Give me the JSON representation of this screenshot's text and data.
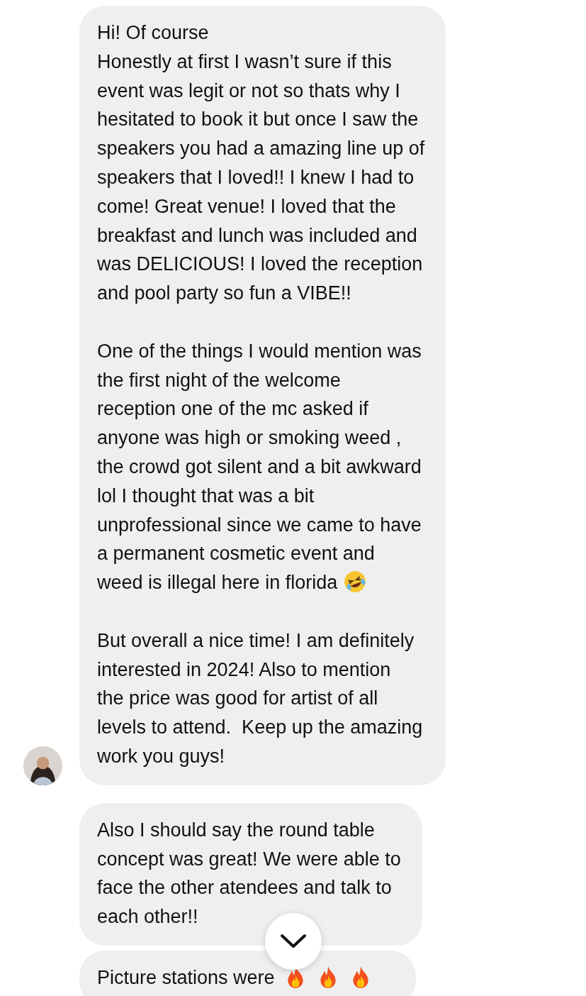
{
  "messages": [
    {
      "avatar": true,
      "paragraphs": [
        {
          "kind": "plain",
          "text": "Hi! Of course\nHonestly at first I wasn’t sure if this\nevent was legit or not so thats why I\nhesitated to book it but once I saw the\nspeakers you had a amazing line up of\nspeakers that I loved!! I knew I had to\ncome! Great venue! I loved that the\nbreakfast and lunch was included and\nwas DELICIOUS! I loved the reception\nand pool party so fun a VIBE!!"
        },
        {
          "kind": "plain",
          "text": "One of the things I would mention was\nthe first night of the welcome\nreception one of the mc asked if\nanyone was high or smoking weed ,\nthe crowd got silent and a bit awkward\nlol I thought that was a bit\nunprofessional since we came to have\na permanent cosmetic event and"
        },
        {
          "kind": "laugh",
          "text": "weed is illegal here in florida"
        },
        {
          "kind": "plain",
          "text": "But overall a nice time! I am definitely\ninterested in 2024! Also to mention\nthe price was good for artist of all\nlevels to attend.  Keep up the amazing\nwork you guys!"
        }
      ]
    },
    {
      "avatar": false,
      "paragraphs": [
        {
          "kind": "plain",
          "text": "Also I should say the round table\nconcept was great! We were able to\nface the other atendees and talk to\neach other!!"
        }
      ]
    },
    {
      "avatar": false,
      "paragraphs": [
        {
          "kind": "fire",
          "text": "Picture stations were"
        }
      ]
    }
  ]
}
